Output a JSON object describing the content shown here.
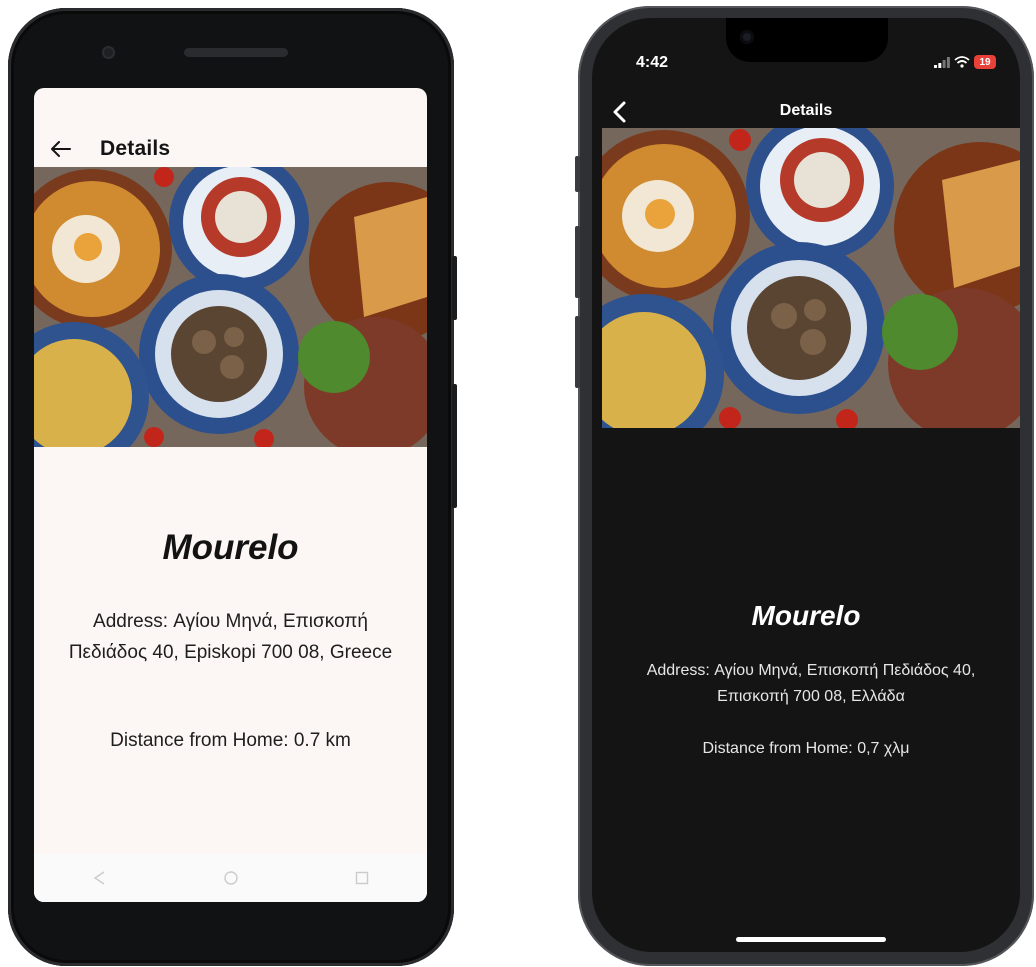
{
  "android": {
    "app_bar": {
      "title": "Details"
    },
    "restaurant": {
      "name": "Mourelo",
      "address": "Address: Αγίου Μηνά, Επισκοπή Πεδιάδος 40, Episkopi 700 08, Greece",
      "distance": "Distance from Home:  0.7 km"
    },
    "icons": {
      "back": "arrow-back-icon",
      "nav_back": "triangle-back-icon",
      "nav_home": "circle-home-icon",
      "nav_recents": "square-recents-icon"
    },
    "colors": {
      "screen_bg": "#fcf6f5",
      "text": "#121212"
    }
  },
  "ios": {
    "status_bar": {
      "time": "4:42",
      "battery": "19"
    },
    "nav_bar": {
      "title": "Details"
    },
    "restaurant": {
      "name": "Mourelo",
      "address": "Address: Αγίου Μηνά, Επισκοπή Πεδιάδος 40, Επισκοπή 700 08, Ελλάδα",
      "distance": "Distance from Home:  0,7 χλμ"
    },
    "icons": {
      "back": "chevron-left-icon",
      "signal": "signal-bars-icon",
      "wifi": "wifi-icon",
      "battery": "battery-icon"
    },
    "colors": {
      "screen_bg": "#141414",
      "text": "#ffffff",
      "battery_low": "#e8413a"
    }
  }
}
